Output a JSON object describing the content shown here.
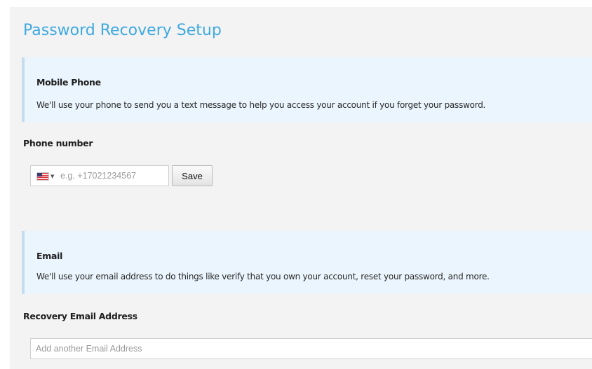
{
  "page": {
    "title": "Password Recovery Setup"
  },
  "mobile_section": {
    "heading": "Mobile Phone",
    "description": "We'll use your phone to send you a text message to help you access your account if you forget your password."
  },
  "phone_field": {
    "label": "Phone number",
    "country_flag": "us-flag-icon",
    "placeholder": "e.g. +17021234567",
    "value": "",
    "save_label": "Save"
  },
  "email_section": {
    "heading": "Email",
    "description": "We'll use your email address to do things like verify that you own your account, reset your password, and more."
  },
  "email_field": {
    "label": "Recovery Email Address",
    "placeholder": "Add another Email Address",
    "value": ""
  },
  "colors": {
    "title": "#3fa9e0",
    "callout_background": "#eaf5fd",
    "callout_border": "#c4dcee",
    "panel_background": "#f3f3f3"
  }
}
